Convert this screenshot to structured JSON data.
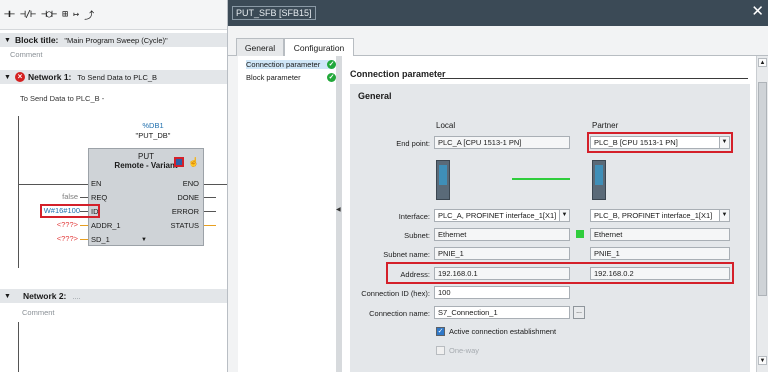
{
  "left": {
    "toolbar_icons": [
      "-||-",
      "-|/|-",
      "-( )-",
      "fb-icon",
      "branch-open-icon",
      "branch-close-icon"
    ],
    "block_title_label": "Block title:",
    "block_title_value": "\"Main Program Sweep (Cycle)\"",
    "comment_label": "Comment",
    "network1_label": "Network 1:",
    "network1_title": "To Send Data to PLC_B",
    "network1_comment": "To Send Data to PLC_B -",
    "db_name": "%DB1",
    "db_instance": "\"PUT_DB\"",
    "fb_name": "PUT",
    "fb_subtitle": "Remote - Variant",
    "pins_left": [
      "EN",
      "REQ",
      "ID",
      "ADDR_1",
      "SD_1"
    ],
    "pins_right": [
      "ENO",
      "DONE",
      "ERROR",
      "STATUS"
    ],
    "req_value": "false",
    "id_value": "W#16#100",
    "addr_value": "<???>",
    "sd_value": "<???>",
    "network2_label": "Network 2:",
    "network2_title": "....",
    "network2_comment": "Comment"
  },
  "dialog": {
    "title": "PUT_SFB [SFB15]",
    "tabs": [
      "General",
      "Configuration"
    ],
    "nav_items": [
      "Connection parameter",
      "Block parameter"
    ],
    "section_title": "Connection parameter",
    "panel_title": "General",
    "col_local": "Local",
    "col_partner": "Partner",
    "endpoint_label": "End point:",
    "endpoint_local": "PLC_A [CPU 1513-1 PN]",
    "endpoint_partner": "PLC_B [CPU 1513-1 PN]",
    "interface_label": "Interface:",
    "interface_local": "PLC_A, PROFINET interface_1[X1]",
    "interface_partner": "PLC_B, PROFINET interface_1[X1]",
    "subnet_label": "Subnet:",
    "subnet_local": "Ethernet",
    "subnet_partner": "Ethernet",
    "subnet_name_label": "Subnet name:",
    "subnet_name_local": "PNIE_1",
    "subnet_name_partner": "PNIE_1",
    "address_label": "Address:",
    "address_local": "192.168.0.1",
    "address_partner": "192.168.0.2",
    "conn_id_label": "Connection ID (hex):",
    "conn_id_value": "100",
    "conn_name_label": "Connection name:",
    "conn_name_value": "S7_Connection_1",
    "ellipsis": "...",
    "active_label": "Active connection establishment",
    "oneway_label": "One-way"
  },
  "colors": {
    "highlight": "#d4202a",
    "check_green": "#22a83a",
    "link_green": "#2fcd3c",
    "title_bar": "#3b4a56"
  }
}
